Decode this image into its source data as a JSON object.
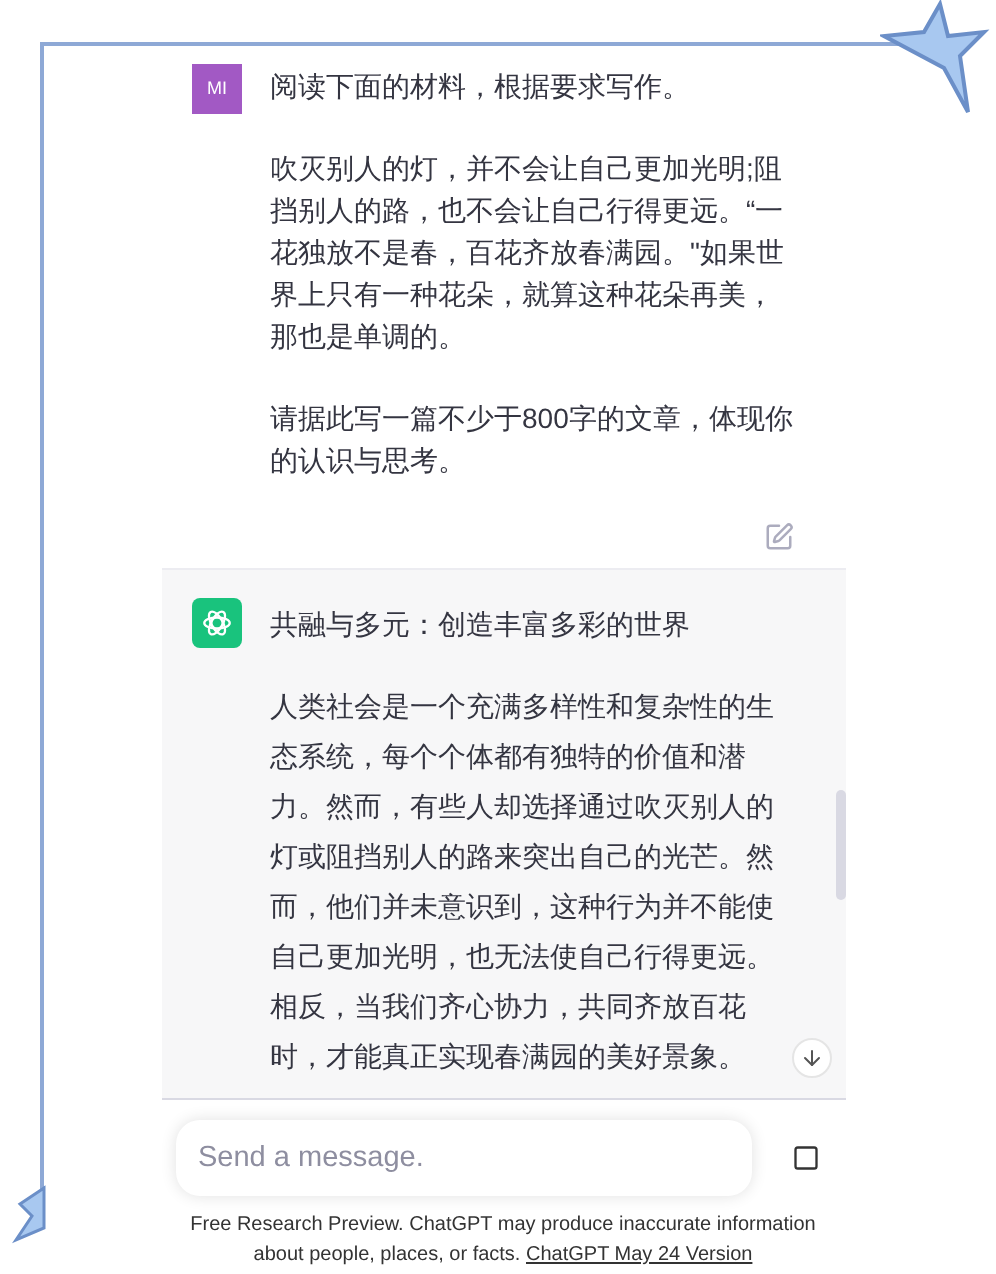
{
  "user_message": {
    "avatar": "MI",
    "paragraphs": [
      "阅读下面的材料，根据要求写作。",
      "吹灭别人的灯，并不会让自己更加光明;阻挡别人的路，也不会让自己行得更远。“一花独放不是春，百花齐放春满园。\"如果世界上只有一种花朵，就算这种花朵再美，那也是单调的。",
      "请据此写一篇不少于800字的文章，体现你的认识与思考。"
    ]
  },
  "assistant_message": {
    "title": "共融与多元：创造丰富多彩的世界",
    "paragraphs": [
      "人类社会是一个充满多样性和复杂性的生态系统，每个个体都有独特的价值和潜力。然而，有些人却选择通过吹灭别人的灯或阻挡别人的路来突出自己的光芒。然而，他们并未意识到，这种行为并不能使自己更加光明，也无法使自己行得更远。相反，当我们齐心协力，共同齐放百花时，才能真正实现春满园的美好景象。"
    ]
  },
  "composer": {
    "placeholder": "Send a message."
  },
  "footer": {
    "text": "Free Research Preview. ChatGPT may produce inaccurate information about people, places, or facts.",
    "link": "ChatGPT May 24 Version"
  }
}
